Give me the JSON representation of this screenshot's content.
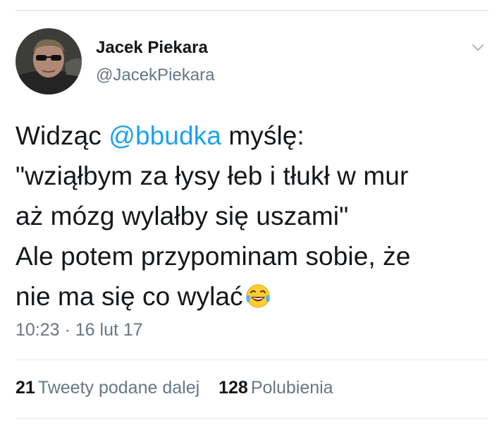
{
  "author": {
    "name": "Jacek Piekara",
    "handle": "@JacekPiekara",
    "avatar_icon": "user-avatar"
  },
  "menu_icon": "chevron-down-icon",
  "tweet": {
    "line1_before": "Widząc ",
    "mention": "@bbudka",
    "line1_after": " myślę:",
    "line2": "\"wziąłbym za łysy łeb i tłukł w mur",
    "line3": "aż mózg wylałby się uszami\"",
    "line4": "Ale potem przypominam sobie, że",
    "line5": "nie ma się co wylać",
    "emoji": "face-with-tears-of-joy"
  },
  "timestamp": "10:23 · 16 lut 17",
  "stats": {
    "retweets_count": "21",
    "retweets_label": "Tweety podane dalej",
    "likes_count": "128",
    "likes_label": "Polubienia"
  },
  "colors": {
    "mention": "#1da1f2",
    "secondary_text": "#657786",
    "primary_text": "#14171a",
    "divider": "#e6ecf0"
  }
}
